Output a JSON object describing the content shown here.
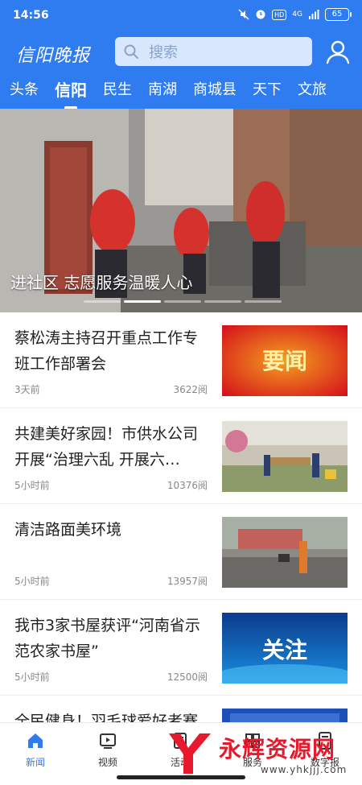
{
  "status_bar": {
    "time": "14:56",
    "network": "4G",
    "battery": "65"
  },
  "header": {
    "logo": "信阳晚报",
    "search_placeholder": "搜索"
  },
  "tabs": [
    {
      "label": "头条",
      "active": false
    },
    {
      "label": "信阳",
      "active": true
    },
    {
      "label": "民生",
      "active": false
    },
    {
      "label": "南湖",
      "active": false
    },
    {
      "label": "商城县",
      "active": false
    },
    {
      "label": "天下",
      "active": false
    },
    {
      "label": "文旅",
      "active": false
    }
  ],
  "banner": {
    "title": "进社区 志愿服务温暖人心",
    "pages": 5,
    "current_page": 2
  },
  "news": [
    {
      "title": "蔡松涛主持召开重点工作专班工作部署会",
      "time": "3天前",
      "reads": "3622阅",
      "thumb_text": "要闻"
    },
    {
      "title": "共建美好家园！市供水公司开展“治理六乱 开展六…",
      "time": "5小时前",
      "reads": "10376阅",
      "thumb_text": ""
    },
    {
      "title": "清洁路面美环境",
      "time": "5小时前",
      "reads": "13957阅",
      "thumb_text": ""
    },
    {
      "title": "我市3家书屋获评“河南省示范农家书屋”",
      "time": "5小时前",
      "reads": "12500阅",
      "thumb_text": "关注"
    },
    {
      "title": "全民健身！羽毛球爱好者赛",
      "time": "",
      "reads": "",
      "thumb_text": ""
    }
  ],
  "bottom_nav": [
    {
      "label": "新闻",
      "icon": "home-icon",
      "active": true
    },
    {
      "label": "视频",
      "icon": "video-icon",
      "active": false
    },
    {
      "label": "活动",
      "icon": "activity-icon",
      "active": false
    },
    {
      "label": "服务",
      "icon": "service-icon",
      "active": false
    },
    {
      "label": "数字报",
      "icon": "newspaper-icon",
      "active": false
    }
  ],
  "watermark": {
    "text": "永辉资源网",
    "url": "www.yhkjjj.com"
  },
  "colors": {
    "brand_blue": "#2f7cf0",
    "text_dark": "#222222",
    "meta_gray": "#888888",
    "watermark_red": "#e8192c"
  }
}
